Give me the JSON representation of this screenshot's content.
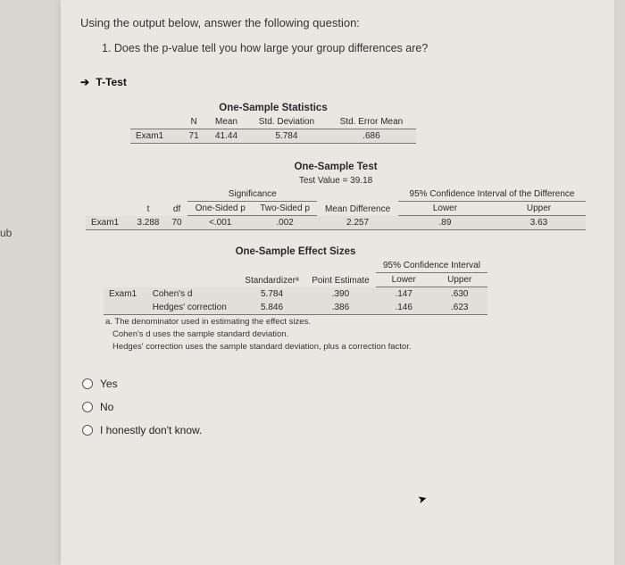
{
  "left_tab": "ub",
  "intro": "Using the output below, answer the following question:",
  "question": "1. Does the p-value tell you how large your group differences are?",
  "ttest_label": "T-Test",
  "table1": {
    "title": "One-Sample Statistics",
    "headers": {
      "n": "N",
      "mean": "Mean",
      "sd": "Std. Deviation",
      "sem": "Std. Error Mean"
    },
    "row_label": "Exam1",
    "n": "71",
    "mean": "41.44",
    "sd": "5.784",
    "sem": ".686"
  },
  "table2": {
    "title": "One-Sample Test",
    "test_value": "Test Value = 39.18",
    "headers": {
      "sig": "Significance",
      "one_sided": "One-Sided p",
      "two_sided": "Two-Sided p",
      "mean_diff": "Mean Difference",
      "ci": "95% Confidence Interval of the Difference",
      "lower": "Lower",
      "upper": "Upper",
      "t": "t",
      "df": "df"
    },
    "row_label": "Exam1",
    "t": "3.288",
    "df": "70",
    "one_sided": "<.001",
    "two_sided": ".002",
    "mean_diff": "2.257",
    "lower": ".89",
    "upper": "3.63"
  },
  "table3": {
    "title": "One-Sample Effect Sizes",
    "headers": {
      "standardizer": "Standardizerᵃ",
      "point_est": "Point Estimate",
      "ci": "95% Confidence Interval",
      "lower": "Lower",
      "upper": "Upper"
    },
    "row1_label": "Exam1",
    "row1_name": "Cohen's d",
    "row2_name": "Hedges' correction",
    "cohens": {
      "std": "5.784",
      "pe": ".390",
      "lower": ".147",
      "upper": ".630"
    },
    "hedges": {
      "std": "5.846",
      "pe": ".386",
      "lower": ".146",
      "upper": ".623"
    },
    "footnote_a": "a. The denominator used in estimating the effect sizes.",
    "footnote_b": "Cohen's d uses the sample standard deviation.",
    "footnote_c": "Hedges' correction uses the sample standard deviation, plus a correction factor."
  },
  "options": {
    "yes": "Yes",
    "no": "No",
    "dontknow": "I honestly don't know."
  }
}
